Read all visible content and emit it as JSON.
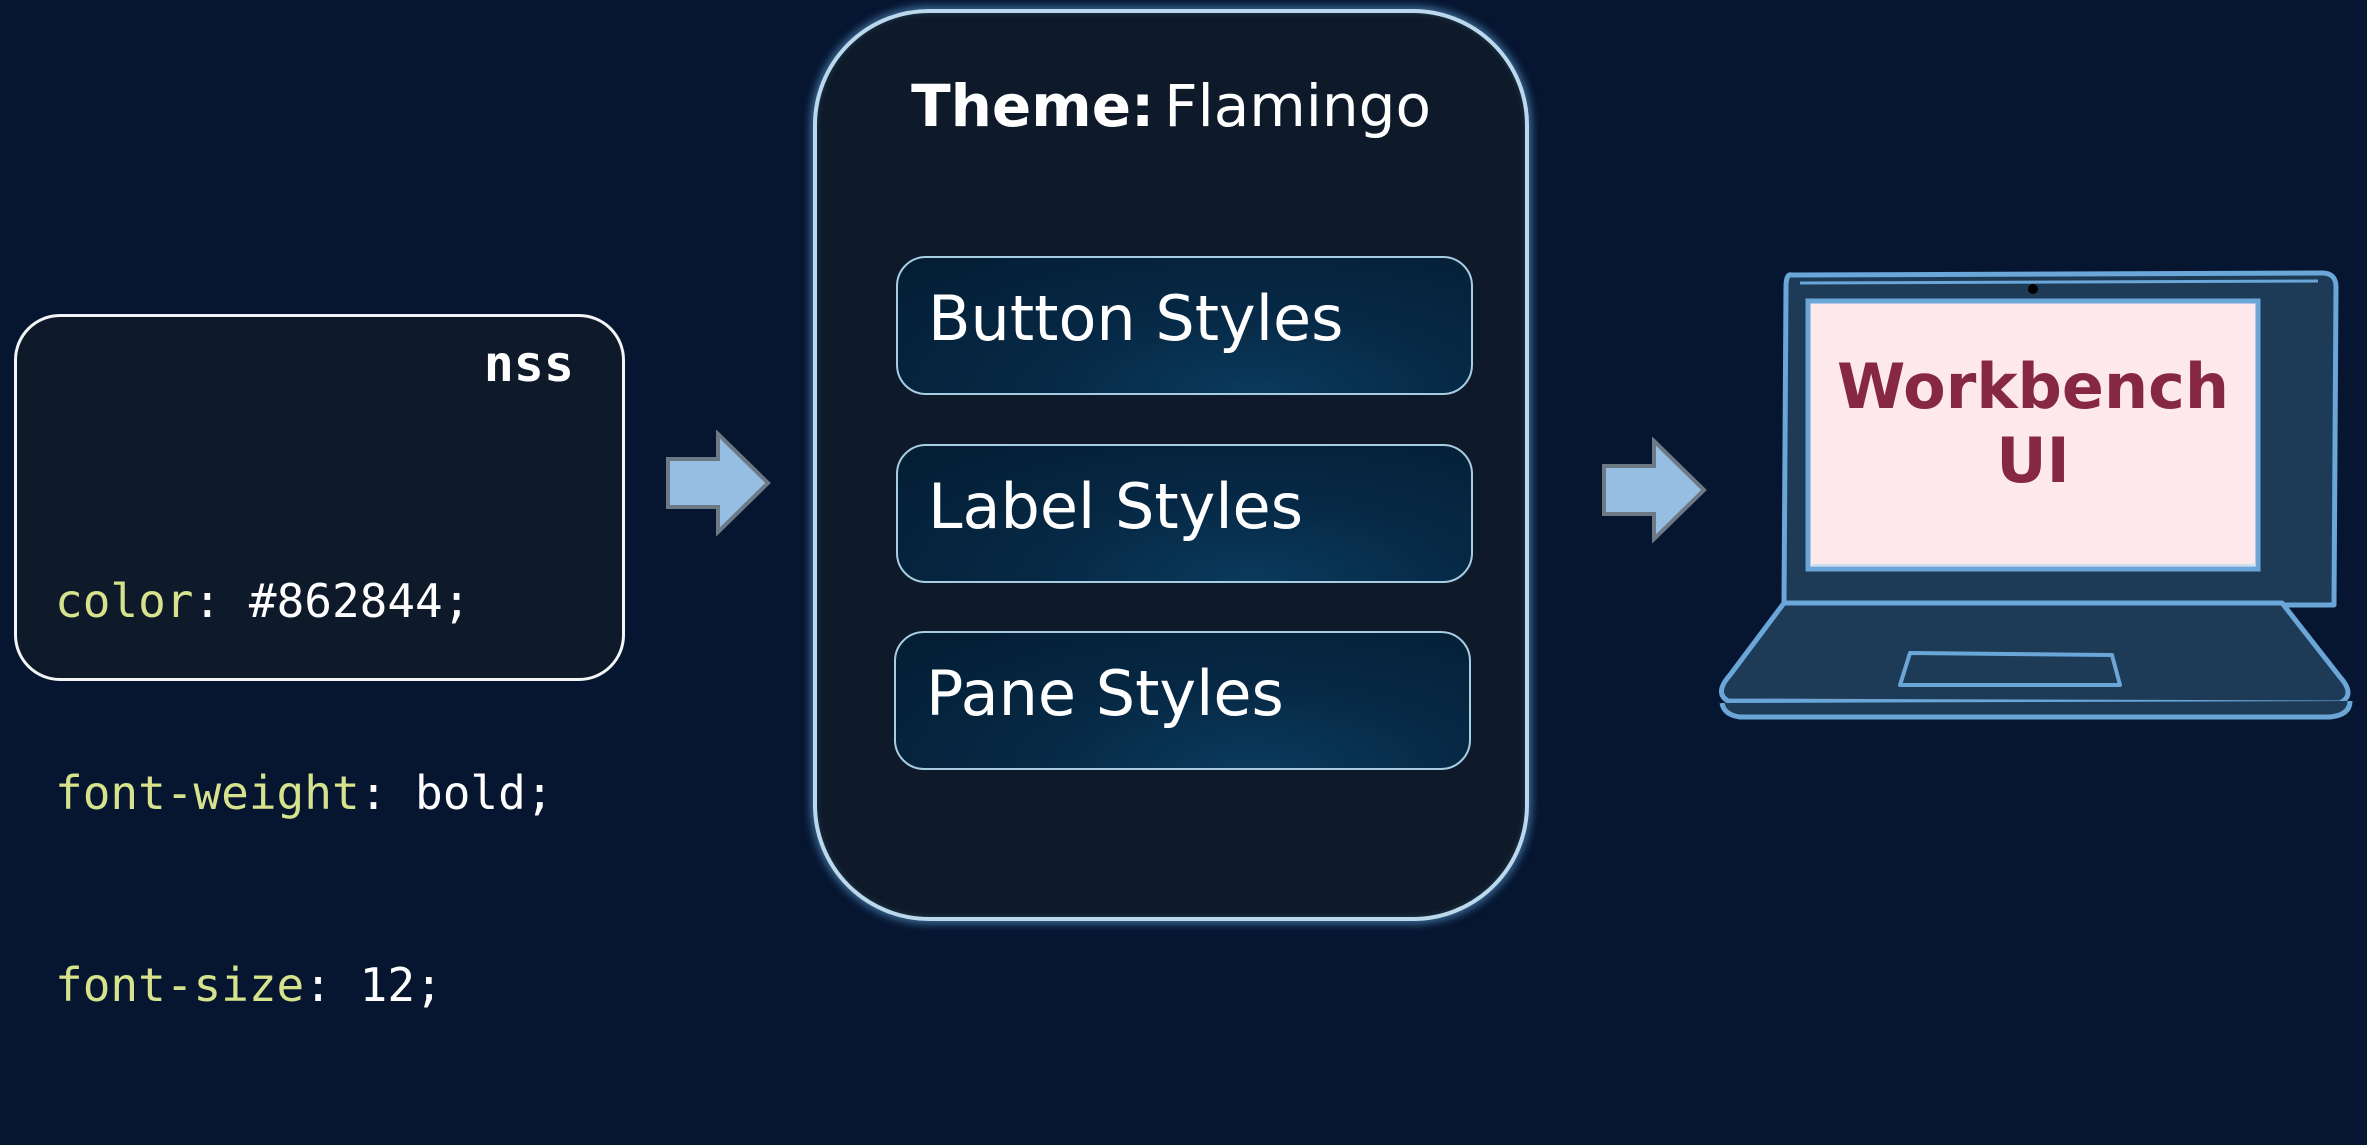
{
  "nss_card": {
    "title": "nss",
    "lines": [
      {
        "property": "color",
        "value": ": #862844;"
      },
      {
        "property": "font-weight",
        "value": ": bold;"
      },
      {
        "property": "font-size",
        "value": ": 12;"
      }
    ]
  },
  "theme": {
    "label": "Theme:",
    "name": "Flamingo",
    "styles": [
      "Button Styles",
      "Label Styles",
      "Pane Styles"
    ]
  },
  "laptop": {
    "screen_line1": "Workbench",
    "screen_line2": "UI",
    "screen_text_color": "#862844",
    "screen_bg_color": "#fde8ec"
  },
  "colors": {
    "background": "#061631",
    "code_property": "#d6e28c",
    "arrow_fill": "#96bde2",
    "laptop_outline": "#6aa6d8"
  }
}
